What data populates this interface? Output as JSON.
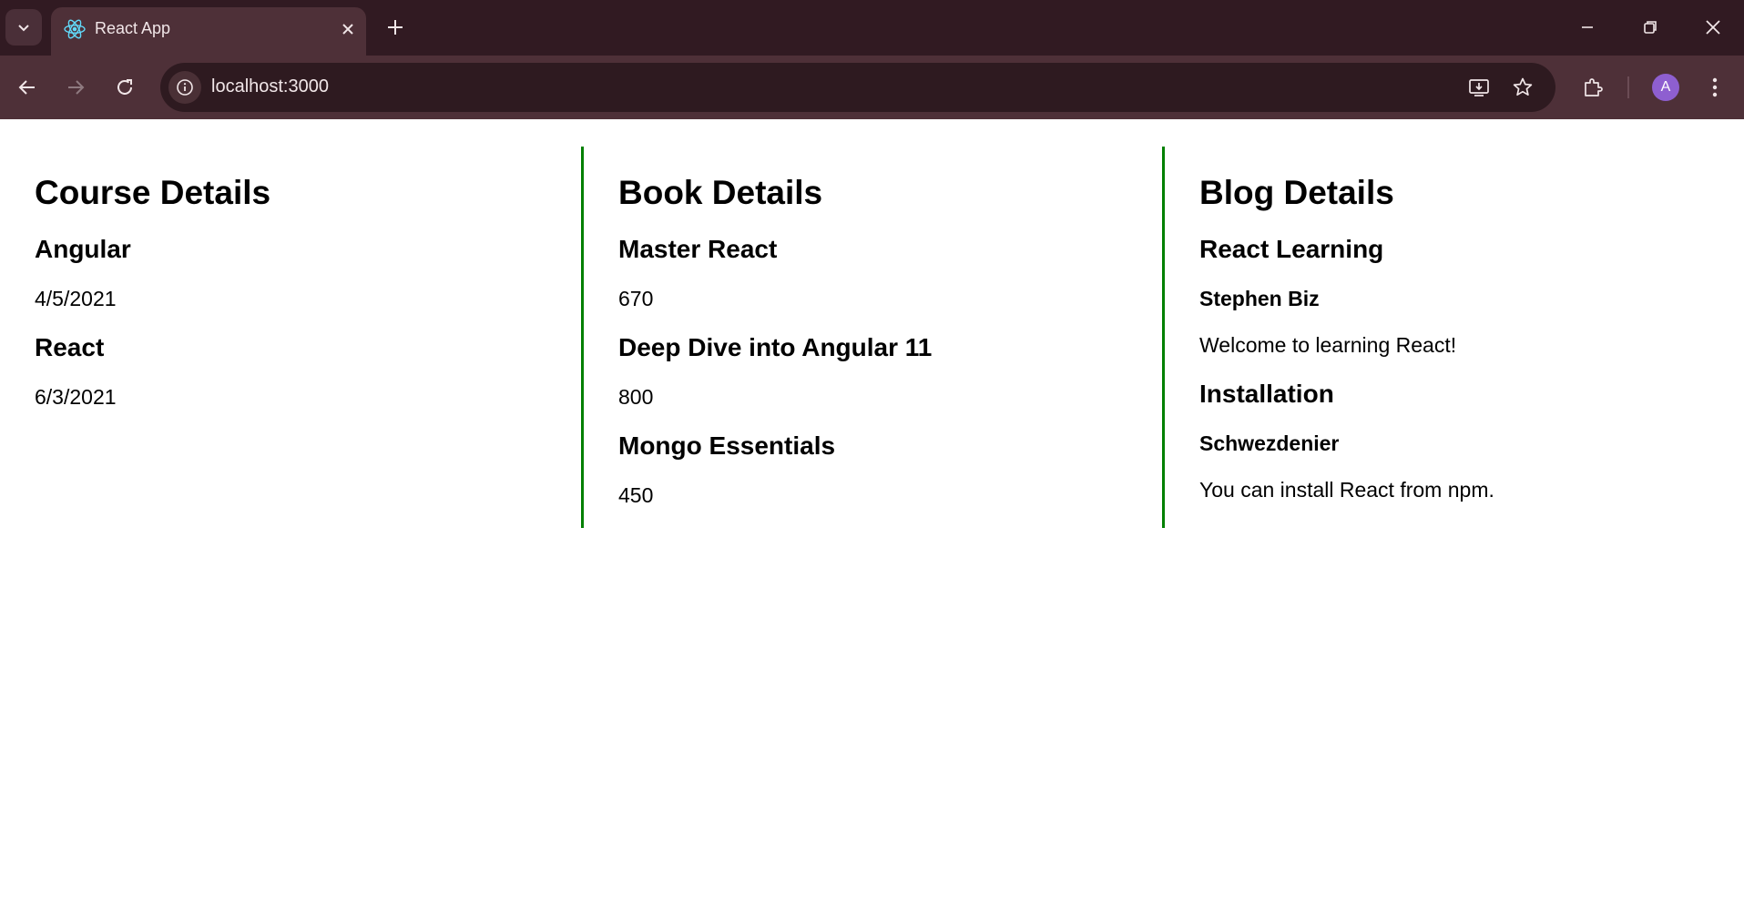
{
  "browser": {
    "tab_title": "React App",
    "url": "localhost:3000",
    "avatar_letter": "A"
  },
  "course": {
    "heading": "Course Details",
    "items": [
      {
        "name": "Angular",
        "date": "4/5/2021"
      },
      {
        "name": "React",
        "date": "6/3/2021"
      }
    ]
  },
  "book": {
    "heading": "Book Details",
    "items": [
      {
        "name": "Master React",
        "price": "670"
      },
      {
        "name": "Deep Dive into Angular 11",
        "price": "800"
      },
      {
        "name": "Mongo Essentials",
        "price": "450"
      }
    ]
  },
  "blog": {
    "heading": "Blog Details",
    "items": [
      {
        "title": "React Learning",
        "author": "Stephen Biz",
        "content": "Welcome to learning React!"
      },
      {
        "title": "Installation",
        "author": "Schwezdenier",
        "content": "You can install React from npm."
      }
    ]
  },
  "colors": {
    "chrome_dark": "#311a22",
    "chrome_tab": "#4e3038",
    "divider_green": "#008000"
  }
}
